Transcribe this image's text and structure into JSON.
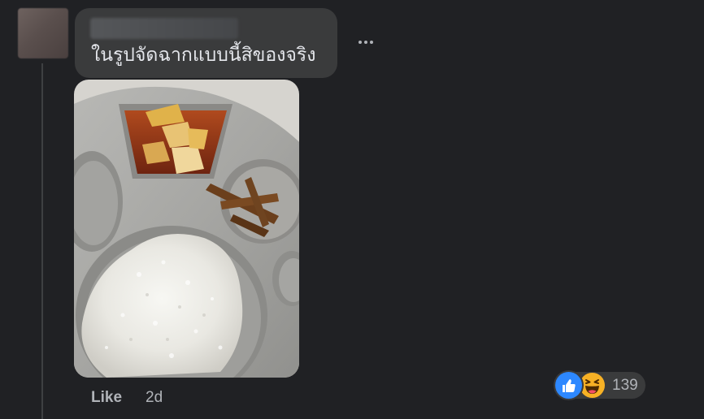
{
  "comment": {
    "text": "ในรูปจัดฉากแบบนี้สิของจริง",
    "timestamp": "2d",
    "like_label": "Like",
    "reaction_count": "139",
    "reactions": [
      "like-icon",
      "haha-icon"
    ],
    "more_icon": "more-options-icon"
  },
  "colors": {
    "background": "#202124",
    "bubble": "#3a3b3c",
    "text": "#e4e6eb",
    "secondary_text": "#b0b3b8",
    "like_blue": "#2d88ff",
    "haha_yellow": "#f7b125"
  }
}
